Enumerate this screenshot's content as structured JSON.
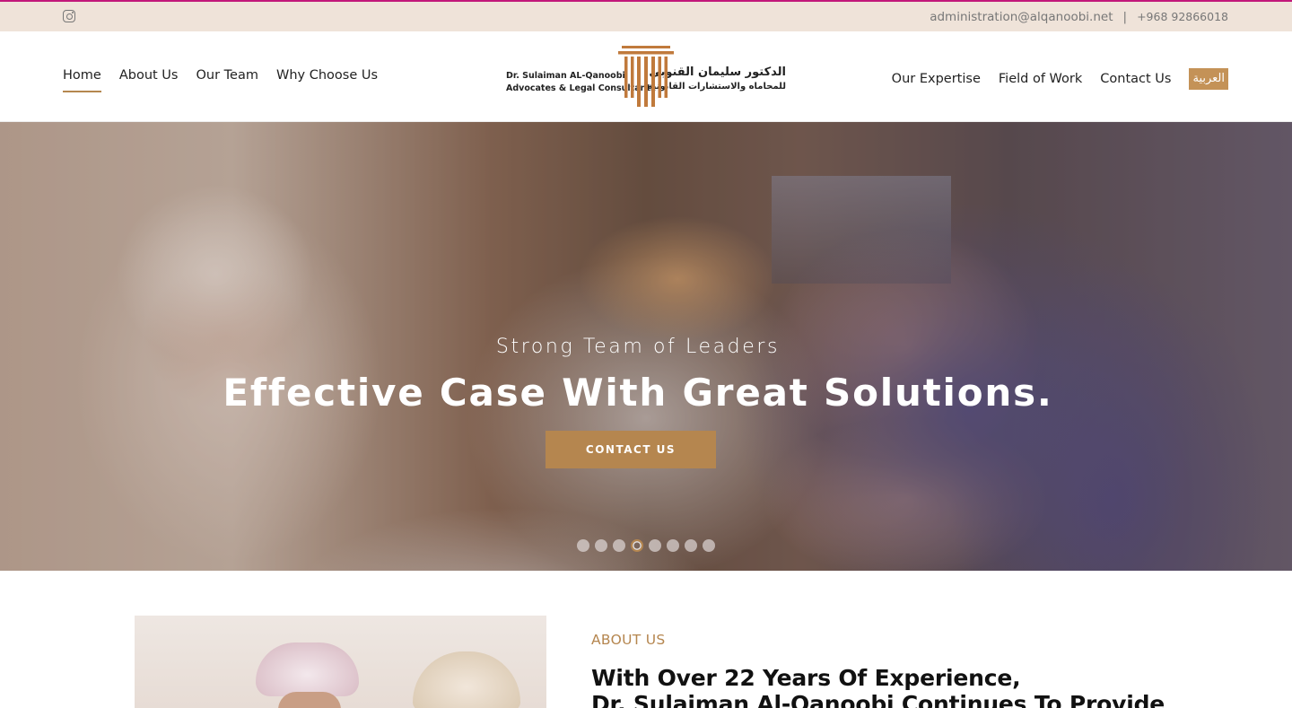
{
  "topbar": {
    "email": "administration@alqanoobi.net",
    "separator": "|",
    "phone": "+968 92866018"
  },
  "nav": {
    "left": [
      "Home",
      "About Us",
      "Our Team",
      "Why Choose Us"
    ],
    "right": [
      "Our Expertise",
      "Field of Work",
      "Contact Us"
    ],
    "language": "العربية",
    "active": "Home"
  },
  "logo": {
    "name_en": "Dr. Sulaiman AL-Qanoobi",
    "subtitle_en": "Advocates & Legal Consultants",
    "name_ar": "الدكتور سليمان القنوبي",
    "subtitle_ar": "للمحاماه والاستشارات القانونية"
  },
  "hero": {
    "subtitle": "Strong Team of Leaders",
    "title": "Effective Case With Great Solutions.",
    "button": "CONTACT US",
    "slide_count": 8,
    "active_slide": 4
  },
  "about": {
    "label": "ABOUT US",
    "heading_line1": "With Over 22 Years Of Experience,",
    "heading_line2": "Dr. Sulaiman Al-Qanoobi Continues To Provide"
  },
  "colors": {
    "accent": "#b5864f",
    "topbar_bg": "#efe3d9",
    "topbar_border": "#c2187a",
    "lang_button": "#c49257"
  },
  "icons": {
    "social": "instagram-icon"
  }
}
